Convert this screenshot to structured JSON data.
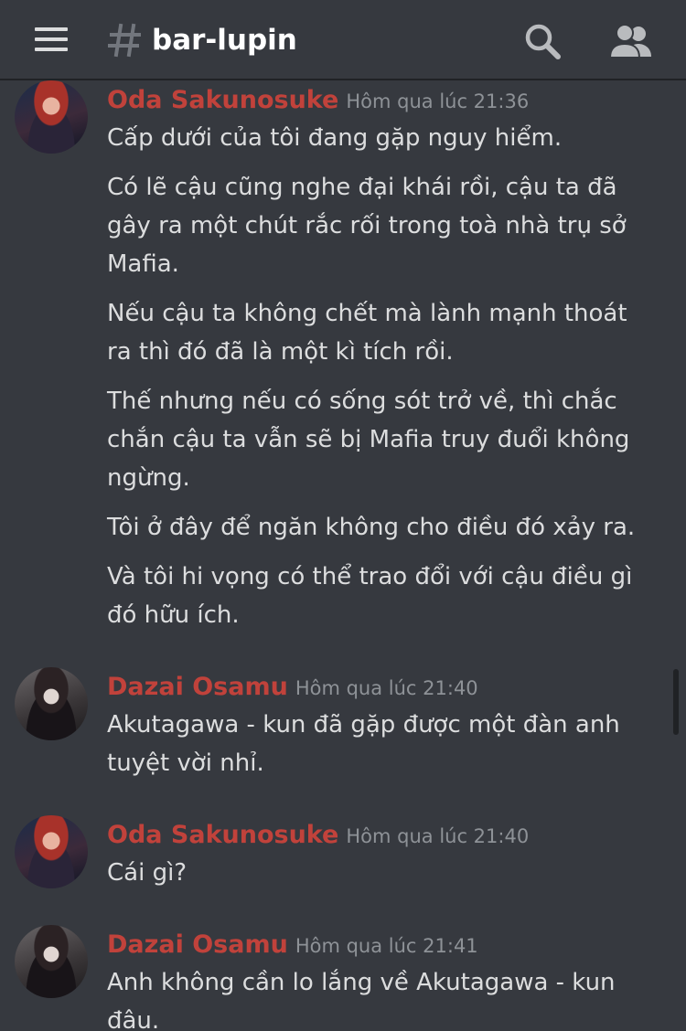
{
  "header": {
    "channel_name": "bar-lupin"
  },
  "messages": [
    {
      "author": "Oda Sakunosuke",
      "timestamp": "Hôm qua lúc 21:36",
      "lines": [
        "Cấp dưới của tôi đang gặp nguy hiểm.",
        "Có lẽ cậu cũng nghe đại khái rồi, cậu ta đã gây ra một chút rắc rối trong toà nhà trụ sở Mafia.",
        "Nếu cậu ta không chết mà lành mạnh thoát ra thì đó đã là một kì tích rồi.",
        "Thế nhưng nếu có sống sót trở về, thì chắc chắn cậu ta vẫn sẽ bị Mafia truy đuổi không ngừng.",
        "Tôi ở đây để ngăn không cho điều đó xảy ra.",
        "Và tôi hi vọng có thể trao đổi với cậu điều gì đó hữu ích."
      ]
    },
    {
      "author": "Dazai Osamu",
      "timestamp": "Hôm qua lúc 21:40",
      "lines": [
        "Akutagawa - kun đã gặp được một đàn anh tuyệt vời nhỉ."
      ]
    },
    {
      "author": "Oda Sakunosuke",
      "timestamp": "Hôm qua lúc 21:40",
      "lines": [
        "Cái gì?"
      ]
    },
    {
      "author": "Dazai Osamu",
      "timestamp": "Hôm qua lúc 21:41",
      "lines": [
        "Anh không cần lo lắng về Akutagawa - kun đâu."
      ]
    }
  ],
  "colors": {
    "background": "#36393f",
    "author_name": "#c1423b",
    "message_text": "#dcddde",
    "timestamp": "#8e9297"
  },
  "icons": [
    "menu-icon",
    "hash-icon",
    "search-icon",
    "members-icon"
  ]
}
